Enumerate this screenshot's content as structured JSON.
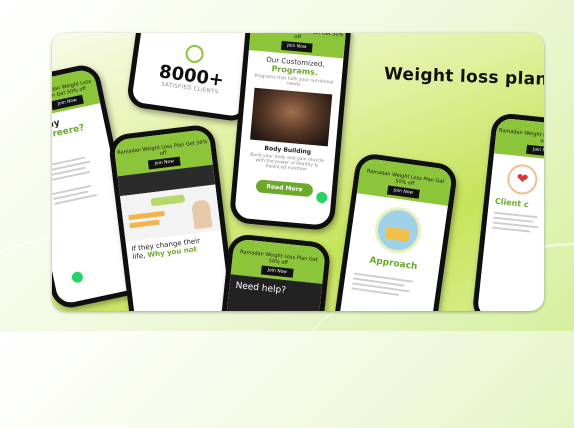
{
  "heading": "Weight  loss plan",
  "promo_banner": "Ramadan Weight Loss Plan Get 50% off",
  "join_label": "Join Now",
  "phone_left": {
    "title_line1": "Why",
    "title_line2": "Bareere?"
  },
  "phone_stats": {
    "count": "8000+",
    "caption": "SATISFIED CLIENTS"
  },
  "phone_programs": {
    "title_line1": "Our Customized,",
    "title_line2": "Programs.",
    "subtitle": "Programs that fulfil your nutritional needs",
    "card_title": "Body Building",
    "card_text": "Build your body and gain muscle with the power of healthy & balanced nutrition",
    "button": "Read More"
  },
  "phone_site": {
    "text_line1": "If they change their",
    "text_line2": "life,",
    "text_accent": "Why you not"
  },
  "phone_help": {
    "text": "Need help?"
  },
  "phone_approach": {
    "title": "Approach"
  },
  "phone_client": {
    "title": "Client c"
  },
  "colors": {
    "accent_green": "#8cc43a",
    "dark_green": "#6aa92c",
    "bezel": "#0f0f0f"
  }
}
